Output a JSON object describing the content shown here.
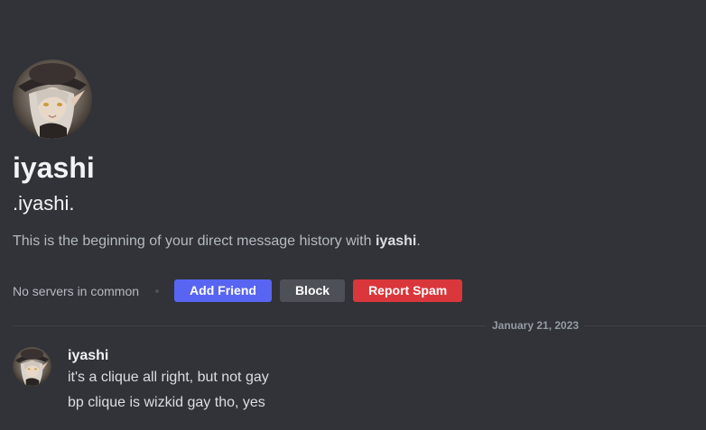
{
  "profile": {
    "display_name": "iyashi",
    "username": ".iyashi.",
    "intro_prefix": "This is the beginning of your direct message history with ",
    "intro_name": "iyashi",
    "intro_suffix": "."
  },
  "actions": {
    "mutual_servers": "No servers in common",
    "add_friend": "Add Friend",
    "block": "Block",
    "report_spam": "Report Spam"
  },
  "divider": {
    "date": "January 21, 2023"
  },
  "messages": [
    {
      "author": "iyashi",
      "lines": [
        "it's a clique all right, but not gay",
        "bp clique is wizkid gay tho, yes"
      ]
    }
  ],
  "colors": {
    "background": "#313338",
    "blurple": "#5865f2",
    "grey_button": "#4e5058",
    "danger": "#da373c"
  }
}
